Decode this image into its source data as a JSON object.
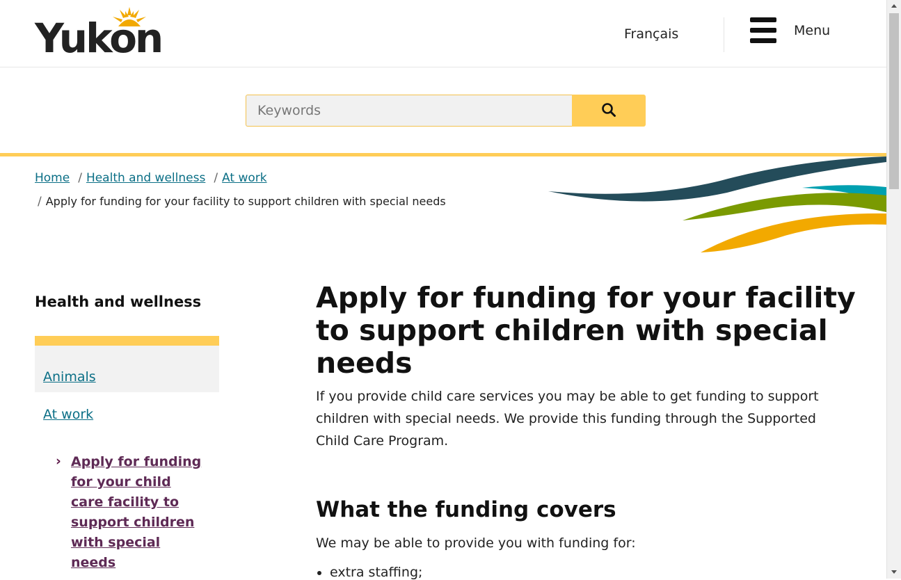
{
  "header": {
    "logo_text": "Yukon",
    "language_link": "Français",
    "menu_label": "Menu"
  },
  "search": {
    "placeholder": "Keywords",
    "button_icon": "search-icon"
  },
  "breadcrumb": {
    "items": [
      "Home",
      "Health and wellness",
      "At work"
    ],
    "current": "Apply for funding for your facility to support children with special needs"
  },
  "sidebar": {
    "title": "Health and wellness",
    "items": [
      {
        "label": "Animals"
      },
      {
        "label": "At work"
      }
    ],
    "sub_item": "Apply for funding for your child care facility to support children with special needs"
  },
  "main": {
    "title": "Apply for funding for your facility to support children with special needs",
    "intro": "If you provide child care services you may be able to get funding to support children with special needs. We provide this funding through the Supported Child Care Program.",
    "section_heading": "What the funding covers",
    "section_intro": "We may be able to provide you with funding for:",
    "list": [
      "extra staffing;"
    ]
  },
  "colors": {
    "accent_yellow": "#ffcd57",
    "link": "#0b6f86",
    "visited_link": "#5e2a55",
    "wave_navy": "#244c5a",
    "wave_teal": "#00a0b0",
    "wave_green": "#7a9a01",
    "wave_gold": "#f2a900"
  }
}
